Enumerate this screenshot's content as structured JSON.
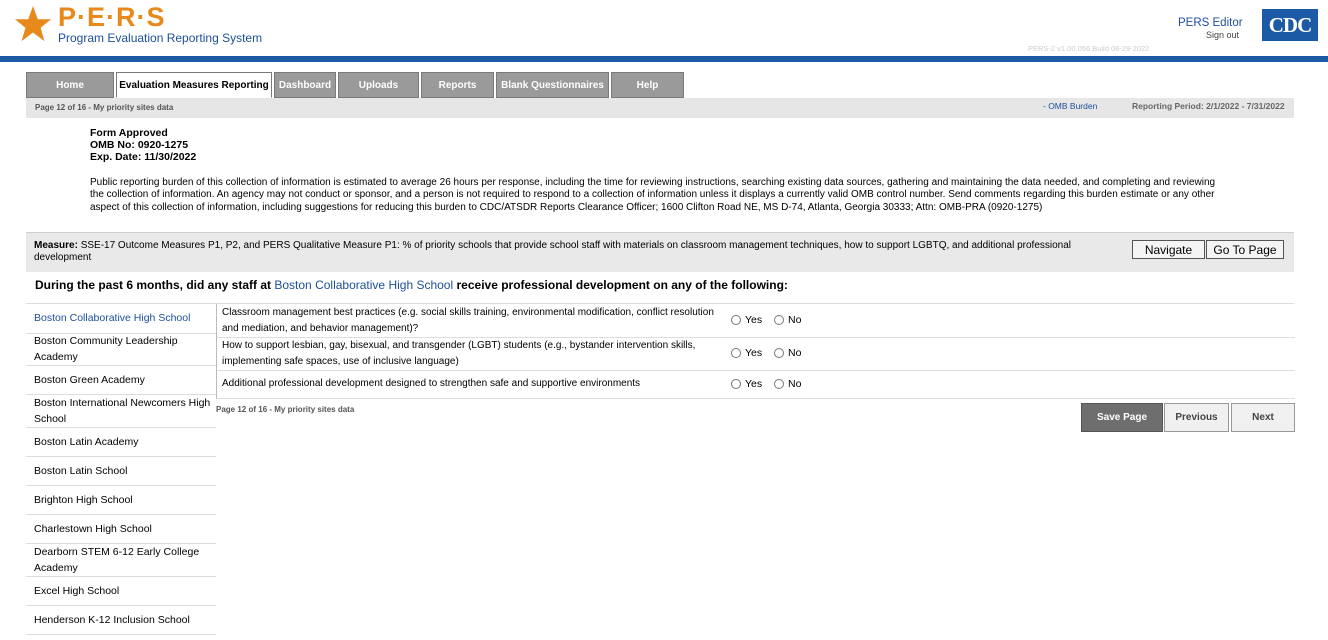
{
  "header": {
    "logo_text": "P·E·R·S",
    "logo_subtitle": "Program Evaluation Reporting System",
    "user_name": "PERS Editor",
    "sign_out": "Sign out",
    "build_info": "PERS-2 v1.00.056   Build 08-29-2022",
    "agency_logo": "CDC",
    "brand_color": "#1d5aa5",
    "accent_color": "#e8891c"
  },
  "tabs": [
    {
      "label": "Home",
      "active": false
    },
    {
      "label": "Evaluation Measures Reporting",
      "active": true
    },
    {
      "label": "Dashboard",
      "active": false
    },
    {
      "label": "Uploads",
      "active": false
    },
    {
      "label": "Reports",
      "active": false
    },
    {
      "label": "Blank Questionnaires",
      "active": false
    },
    {
      "label": "Help",
      "active": false
    }
  ],
  "subbar": {
    "page_info": "Page 12 of 16 - My priority sites data",
    "omb_link": "- OMB Burden",
    "reporting_period": "Reporting Period: 2/1/2022 - 7/31/2022"
  },
  "omb": {
    "line1": "Form Approved",
    "line2": "OMB No: 0920-1275",
    "line3": "Exp. Date: 11/30/2022",
    "burden_text": "Public reporting burden of this collection of information is estimated to average 26 hours per response, including the time for reviewing instructions, searching existing data sources, gathering and maintaining the data needed, and completing and reviewing the collection of information. An agency may not conduct or sponsor, and a person is not required to respond to a collection of information unless it displays a currently valid OMB control number. Send comments regarding this burden estimate or any other aspect of this collection of information, including suggestions for reducing this burden to CDC/ATSDR Reports Clearance Officer; 1600 Clifton Road NE, MS D-74, Atlanta, Georgia 30333; Attn: OMB-PRA (0920-1275)"
  },
  "measure": {
    "label": "Measure:",
    "text": "SSE-17 Outcome Measures P1, P2, and PERS Qualitative Measure P1: % of priority schools that provide school staff with materials on classroom management techniques, how to support LGBTQ, and additional professional development",
    "navigate_button": "Navigate",
    "goto_button": "Go To Page"
  },
  "question": {
    "prefix": "During the past 6 months, did any staff at",
    "school": "Boston Collaborative High School",
    "suffix": "receive professional development on any of the following:"
  },
  "schools": [
    {
      "name": "Boston Collaborative High School",
      "active": true
    },
    {
      "name": "Boston Community Leadership Academy",
      "active": false
    },
    {
      "name": "Boston Green Academy",
      "active": false
    },
    {
      "name": "Boston International Newcomers High School",
      "active": false
    },
    {
      "name": "Boston Latin Academy",
      "active": false
    },
    {
      "name": "Boston Latin School",
      "active": false
    },
    {
      "name": "Brighton High School",
      "active": false
    },
    {
      "name": "Charlestown High School",
      "active": false
    },
    {
      "name": "Dearborn STEM 6-12 Early College Academy",
      "active": false
    },
    {
      "name": "Excel High School",
      "active": false
    },
    {
      "name": "Henderson K-12 Inclusion School",
      "active": false
    }
  ],
  "items": [
    {
      "text": "Classroom management best practices (e.g. social skills training, environmental modification, conflict resolution and mediation, and behavior management)?",
      "yes": "Yes",
      "no": "No"
    },
    {
      "text": "How to support lesbian, gay, bisexual, and transgender (LGBT) students (e.g., bystander intervention skills, implementing safe spaces, use of inclusive language)",
      "yes": "Yes",
      "no": "No"
    },
    {
      "text": "Additional professional development designed to strengthen safe and supportive environments",
      "yes": "Yes",
      "no": "No"
    }
  ],
  "footer": {
    "page_info": "Page 12 of 16 - My priority sites data",
    "save": "Save Page",
    "previous": "Previous",
    "next": "Next"
  }
}
